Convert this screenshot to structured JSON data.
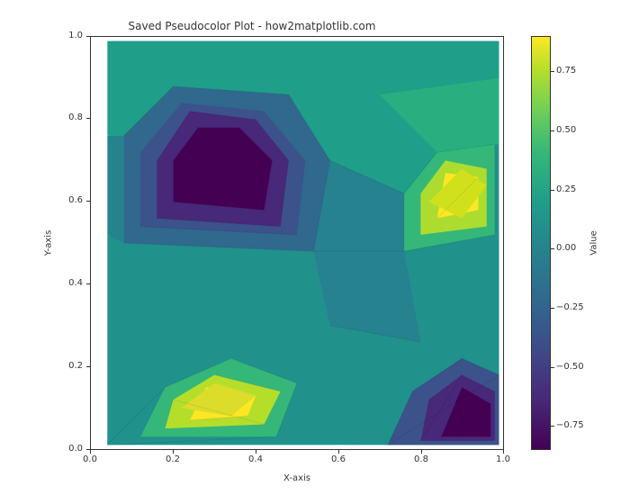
{
  "chart_data": {
    "type": "heatmap",
    "subtype": "pseudocolor-triangulation",
    "title": "Saved Pseudocolor Plot - how2matplotlib.com",
    "xlabel": "X-axis",
    "ylabel": "Y-axis",
    "xlim": [
      0.0,
      1.0
    ],
    "ylim": [
      0.0,
      1.0
    ],
    "colorbar": {
      "label": "Value",
      "vmin": -0.85,
      "vmax": 0.9,
      "cmap": "viridis"
    },
    "xticks": [
      0.0,
      0.2,
      0.4,
      0.6,
      0.8,
      1.0
    ],
    "yticks": [
      0.0,
      0.2,
      0.4,
      0.6,
      0.8,
      1.0
    ],
    "colorbar_ticks": [
      -0.75,
      -0.5,
      -0.25,
      0.0,
      0.25,
      0.5,
      0.75
    ],
    "description": "Delaunay-triangulated pseudocolor field over unit square. Approximate local means: dark patch around (0.30,0.68) value≈-0.80; dark patch around (0.88,0.08) value≈-0.78; bright patch around (0.30,0.10) value≈+0.80; bright patch around (0.86,0.60) value≈+0.80; mid-teal background value≈+0.15.",
    "samples": [
      {
        "x": 0.3,
        "y": 0.68,
        "value": -0.8
      },
      {
        "x": 0.88,
        "y": 0.08,
        "value": -0.78
      },
      {
        "x": 0.3,
        "y": 0.1,
        "value": 0.8
      },
      {
        "x": 0.86,
        "y": 0.6,
        "value": 0.8
      },
      {
        "x": 0.05,
        "y": 0.05,
        "value": 0.15
      },
      {
        "x": 0.6,
        "y": 0.4,
        "value": 0.15
      },
      {
        "x": 0.95,
        "y": 0.95,
        "value": 0.15
      },
      {
        "x": 0.05,
        "y": 0.95,
        "value": 0.25
      }
    ]
  },
  "ticks": {
    "x": [
      "0.0",
      "0.2",
      "0.4",
      "0.6",
      "0.8",
      "1.0"
    ],
    "y": [
      "0.0",
      "0.2",
      "0.4",
      "0.6",
      "0.8",
      "1.0"
    ],
    "cb": [
      "−0.75",
      "−0.50",
      "−0.25",
      "0.00",
      "0.25",
      "0.50",
      "0.75"
    ]
  }
}
